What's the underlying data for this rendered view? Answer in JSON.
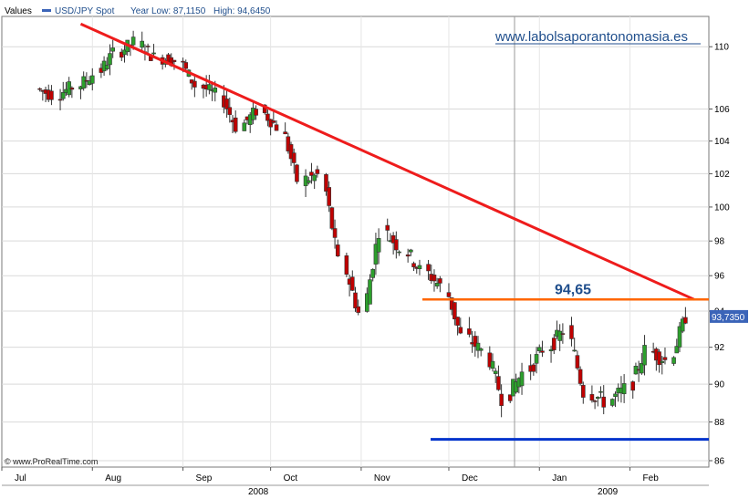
{
  "header": {
    "values_label": "Values",
    "series_name": "USD/JPY Spot",
    "year_low_label": "Year Low: 87,1150",
    "year_high_label": "High: 94,6450"
  },
  "watermark": "www.labolsaporantonomasia.es",
  "footer_credit": "© www.ProRealTime.com",
  "colors": {
    "up_candle": "#2ca02c",
    "down_candle": "#c00000",
    "trendline": "#ee1c1c",
    "resistance": "#ff6600",
    "support": "#0033cc",
    "label_text": "#1f4e8c",
    "last_price_tag": "#3b64b8"
  },
  "chart_data": {
    "type": "candlestick",
    "title": "",
    "xlabel": "",
    "ylabel": "",
    "series_name": "USD/JPY Spot",
    "y_scale": "log",
    "ylim": [
      86,
      112
    ],
    "y_ticks": [
      86,
      88,
      90,
      92,
      94,
      96,
      98,
      100,
      102,
      104,
      106,
      110
    ],
    "x_month_labels": [
      "Jul",
      "Aug",
      "Sep",
      "Oct",
      "Nov",
      "Dec",
      "Jan",
      "Feb"
    ],
    "x_year_labels": [
      "2008",
      "2009"
    ],
    "grid": "horizontal at y ticks, vertical at month boundaries",
    "last_price": "93,7350",
    "resistance": {
      "value": 94.65,
      "label": "94,65"
    },
    "support": {
      "value": 87.1
    },
    "trendline": {
      "from": {
        "date": "2008-07-28",
        "value": 111.5
      },
      "to": {
        "date": "2009-02-23",
        "value": 94.65
      }
    },
    "closes": [
      {
        "date": "2008-07-14",
        "close": 106.9
      },
      {
        "date": "2008-07-21",
        "close": 107.4
      },
      {
        "date": "2008-07-28",
        "close": 108.2
      },
      {
        "date": "2008-08-04",
        "close": 109.6
      },
      {
        "date": "2008-08-11",
        "close": 110.3
      },
      {
        "date": "2008-08-18",
        "close": 109.3
      },
      {
        "date": "2008-08-25",
        "close": 109.1
      },
      {
        "date": "2008-09-01",
        "close": 107.5
      },
      {
        "date": "2008-09-08",
        "close": 106.9
      },
      {
        "date": "2008-09-15",
        "close": 104.9
      },
      {
        "date": "2008-09-22",
        "close": 105.9
      },
      {
        "date": "2008-09-29",
        "close": 104.9
      },
      {
        "date": "2008-10-06",
        "close": 101.6
      },
      {
        "date": "2008-10-13",
        "close": 101.9
      },
      {
        "date": "2008-10-20",
        "close": 96.8
      },
      {
        "date": "2008-10-27",
        "close": 93.9
      },
      {
        "date": "2008-11-03",
        "close": 98.6
      },
      {
        "date": "2008-11-10",
        "close": 97.6
      },
      {
        "date": "2008-11-17",
        "close": 96.3
      },
      {
        "date": "2008-11-24",
        "close": 95.4
      },
      {
        "date": "2008-12-01",
        "close": 92.6
      },
      {
        "date": "2008-12-08",
        "close": 91.8
      },
      {
        "date": "2008-12-15",
        "close": 89.3
      },
      {
        "date": "2008-12-22",
        "close": 90.6
      },
      {
        "date": "2008-12-29",
        "close": 91.9
      },
      {
        "date": "2009-01-05",
        "close": 92.9
      },
      {
        "date": "2009-01-12",
        "close": 89.6
      },
      {
        "date": "2009-01-19",
        "close": 89.1
      },
      {
        "date": "2009-01-26",
        "close": 89.7
      },
      {
        "date": "2009-02-02",
        "close": 91.8
      },
      {
        "date": "2009-02-09",
        "close": 91.3
      },
      {
        "date": "2009-02-16",
        "close": 93.7
      }
    ]
  }
}
